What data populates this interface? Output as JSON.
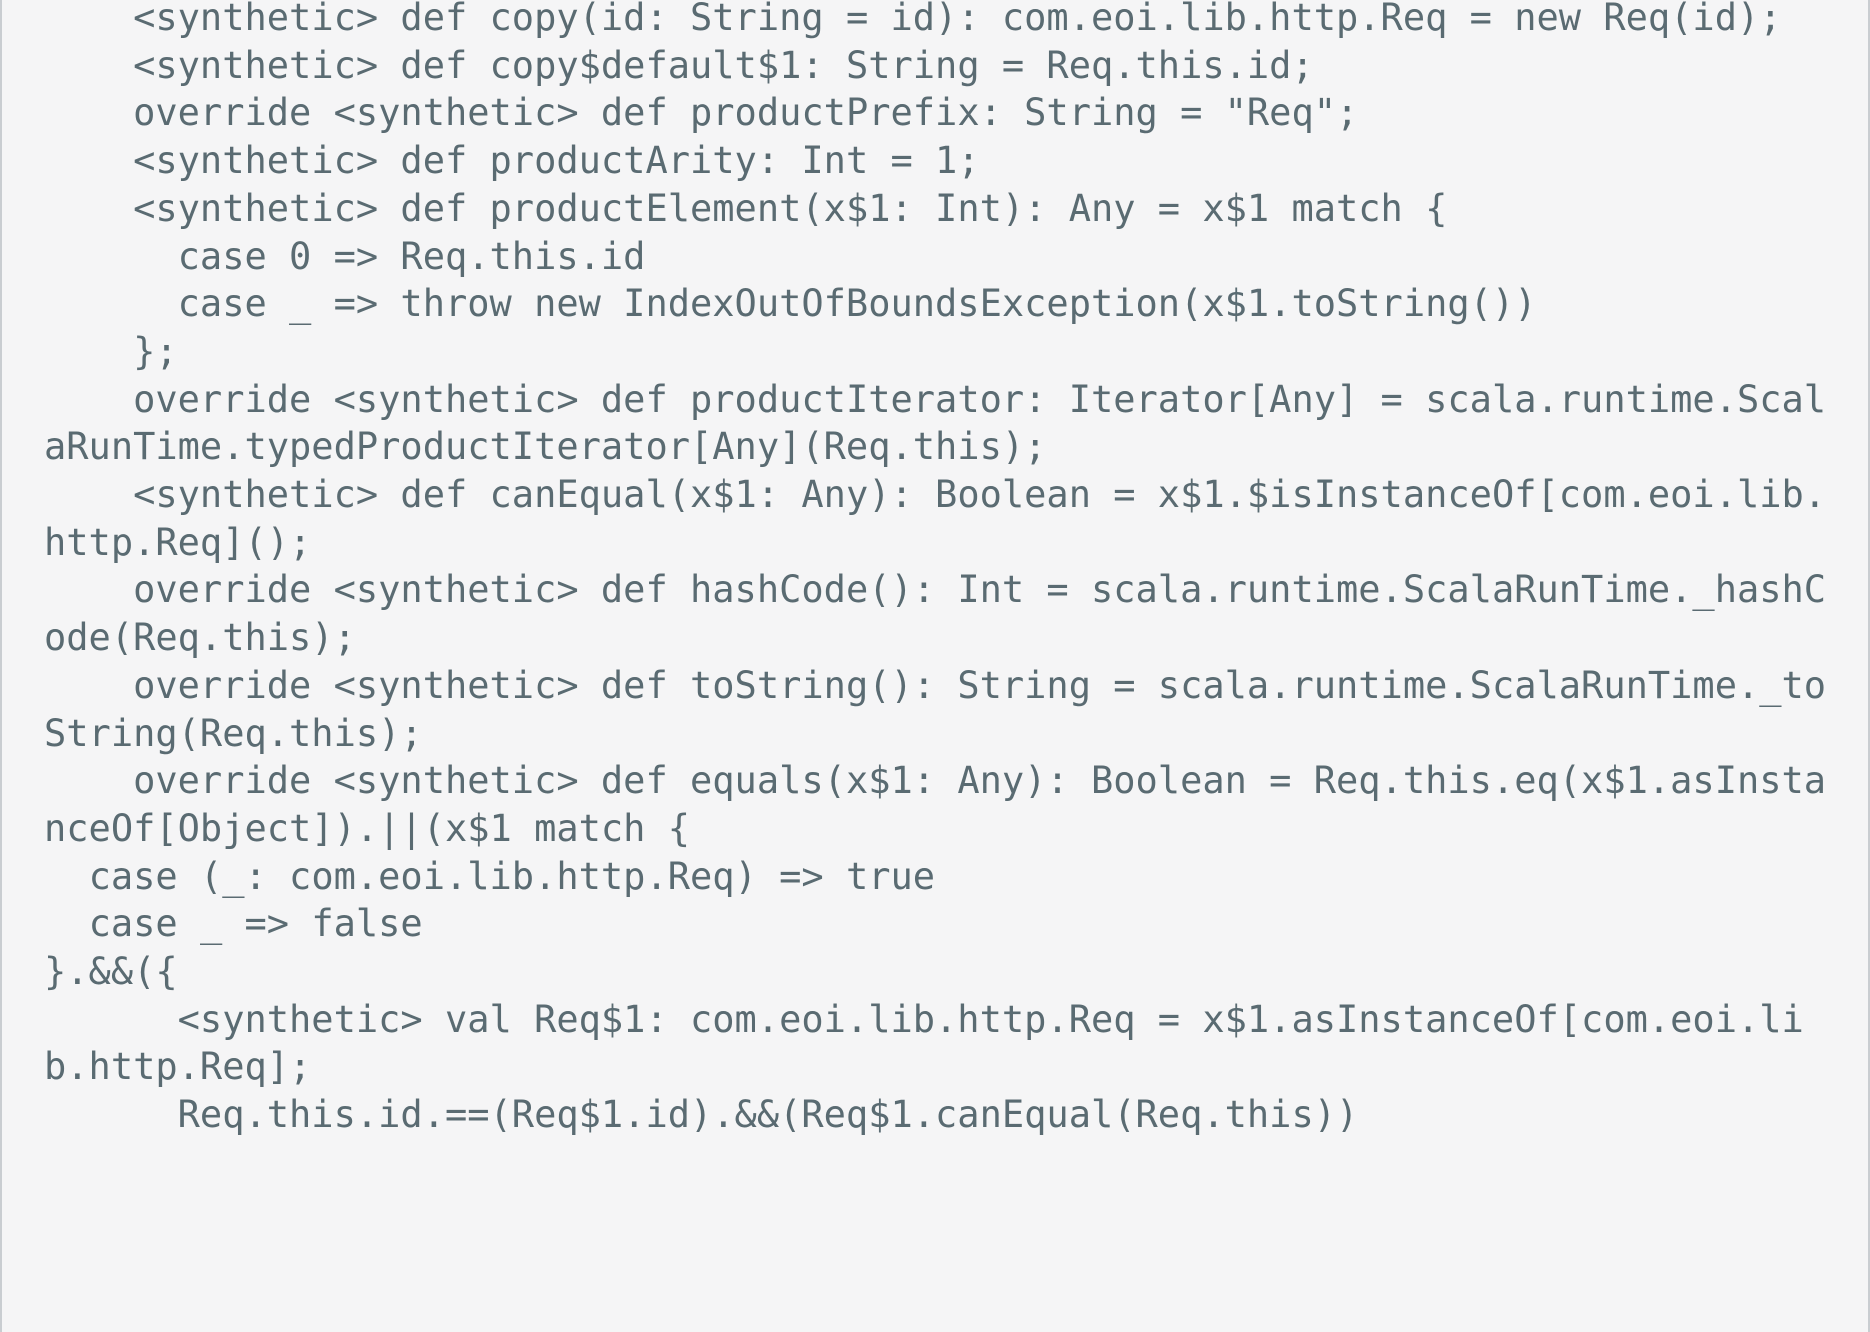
{
  "editor": {
    "language": "scala",
    "kind": "compiler-output-pane",
    "background_color": "#f5f5f6",
    "text_color": "#5a6b72",
    "border_color": "#c9cdd1",
    "font_size_px": 37,
    "line_height_px": 47.7,
    "wrap": "soft-wrap",
    "wrap_column": 80,
    "code": "    <synthetic> def copy(id: String = id): com.eoi.lib.http.Req = new Req(id);\n    <synthetic> def copy$default$1: String = Req.this.id;\n    override <synthetic> def productPrefix: String = \"Req\";\n    <synthetic> def productArity: Int = 1;\n    <synthetic> def productElement(x$1: Int): Any = x$1 match {\n      case 0 => Req.this.id\n      case _ => throw new IndexOutOfBoundsException(x$1.toString())\n    };\n    override <synthetic> def productIterator: Iterator[Any] = scala.runtime.ScalaRunTime.typedProductIterator[Any](Req.this);\n    <synthetic> def canEqual(x$1: Any): Boolean = x$1.$isInstanceOf[com.eoi.lib.http.Req]();\n    override <synthetic> def hashCode(): Int = scala.runtime.ScalaRunTime._hashCode(Req.this);\n    override <synthetic> def toString(): String = scala.runtime.ScalaRunTime._toString(Req.this);\n    override <synthetic> def equals(x$1: Any): Boolean = Req.this.eq(x$1.asInstanceOf[Object]).||(x$1 match {\n  case (_: com.eoi.lib.http.Req) => true\n  case _ => false\n}.&&({\n      <synthetic> val Req$1: com.eoi.lib.http.Req = x$1.asInstanceOf[com.eoi.lib.http.Req];\n      Req.this.id.==(Req$1.id).&&(Req$1.canEqual(Req.this))\n",
    "lines": [
      "    <synthetic> def copy(id: String = id): com.eoi.lib.http.Req = new Req(id);",
      "    <synthetic> def copy$default$1: String = Req.this.id;",
      "    override <synthetic> def productPrefix: String = \"Req\";",
      "    <synthetic> def productArity: Int = 1;",
      "    <synthetic> def productElement(x$1: Int): Any = x$1 match {",
      "      case 0 => Req.this.id",
      "      case _ => throw new IndexOutOfBoundsException(x$1.toString())",
      "    };",
      "    override <synthetic> def productIterator: Iterator[Any] = scala.runtime.ScalaRunTime.typedProductIterator[Any](Req.this);",
      "    <synthetic> def canEqual(x$1: Any): Boolean = x$1.$isInstanceOf[com.eoi.lib.http.Req]();",
      "    override <synthetic> def hashCode(): Int = scala.runtime.ScalaRunTime._hashCode(Req.this);",
      "    override <synthetic> def toString(): String = scala.runtime.ScalaRunTime._toString(Req.this);",
      "    override <synthetic> def equals(x$1: Any): Boolean = Req.this.eq(x$1.asInstanceOf[Object]).||(x$1 match {",
      "  case (_: com.eoi.lib.http.Req) => true",
      "  case _ => false",
      "}.&&({",
      "      <synthetic> val Req$1: com.eoi.lib.http.Req = x$1.asInstanceOf[com.eoi.lib.http.Req];",
      "      Req.this.id.==(Req$1.id).&&(Req$1.canEqual(Req.this))"
    ],
    "visual_rows": [
      "    <synthetic> def copy(id: String = id): com.eoi.lib.http.Req = new Req(id);",
      "    <synthetic> def copy$default$1: String = Req.this.id;",
      "    override <synthetic> def productPrefix: String = \"Req\";",
      "    <synthetic> def productArity: Int = 1;",
      "    <synthetic> def productElement(x$1: Int): Any = x$1 match {",
      "      case 0 => Req.this.id",
      "      case _ => throw new IndexOutOfBoundsException(x$1.toString())",
      "    };",
      "    override <synthetic> def productIterator: Iterator[Any] = scala.runtime.ScalaRunTime",
      ".typedProductIterator[Any](Req.this);",
      "    <synthetic> def canEqual(x$1: Any): Boolean = x$1.$isInstanceOf[com.eoi.lib.http.Req",
      "]();",
      "    override <synthetic> def hashCode(): Int = scala.runtime.ScalaRunTime._hashCode(Req.",
      "this);",
      "    override <synthetic> def toString(): String = scala.runtime.ScalaRunTime._toString(R",
      "eq.this);",
      "    override <synthetic> def equals(x$1: Any): Boolean = Req.this.eq(x$1.asInstanceOf[Ob",
      "ject]).||(x$1 match {",
      "  case (_: com.eoi.lib.http.Req) => true",
      "  case _ => false",
      "}.&&({",
      "      <synthetic> val Req$1: com.eoi.lib.http.Req = x$1.asInstanceOf[com.eoi.lib.http.Re",
      "q];",
      "      Req.this.id.==(Req$1.id).&&(Req$1.canEqual(Req.this))"
    ]
  }
}
